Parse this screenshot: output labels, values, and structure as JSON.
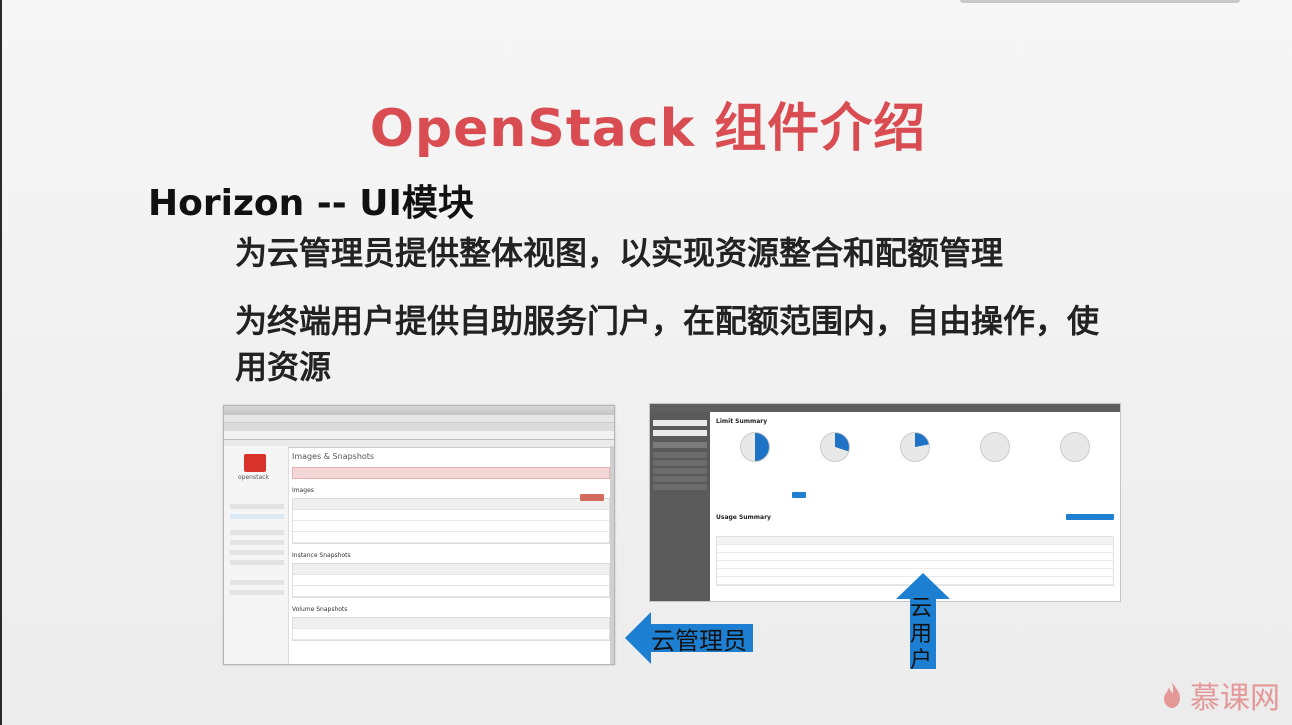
{
  "slide": {
    "title": "OpenStack 组件介绍",
    "subtitle": "Horizon -- UI模块",
    "bullets": [
      "为云管理员提供整体视图，以实现资源整合和配额管理",
      "为终端用户提供自助服务门户，在配额范围内，自由操作，使用资源"
    ],
    "labels": {
      "admin": "云管理员",
      "user_chars": [
        "云",
        "用",
        "户"
      ]
    }
  },
  "shot1": {
    "logo": "openstack",
    "page_title": "Images & Snapshots",
    "section_images": "Images",
    "section_instance_snapshots": "Instance Snapshots",
    "section_volume_snapshots": "Volume Snapshots"
  },
  "shot2": {
    "limit_summary": "Limit Summary",
    "usage_summary": "Usage Summary"
  },
  "watermark": {
    "text": "慕课网"
  },
  "colors": {
    "title": "#d94d52",
    "arrow": "#1d7fd1",
    "watermark": "#e06b6b"
  }
}
